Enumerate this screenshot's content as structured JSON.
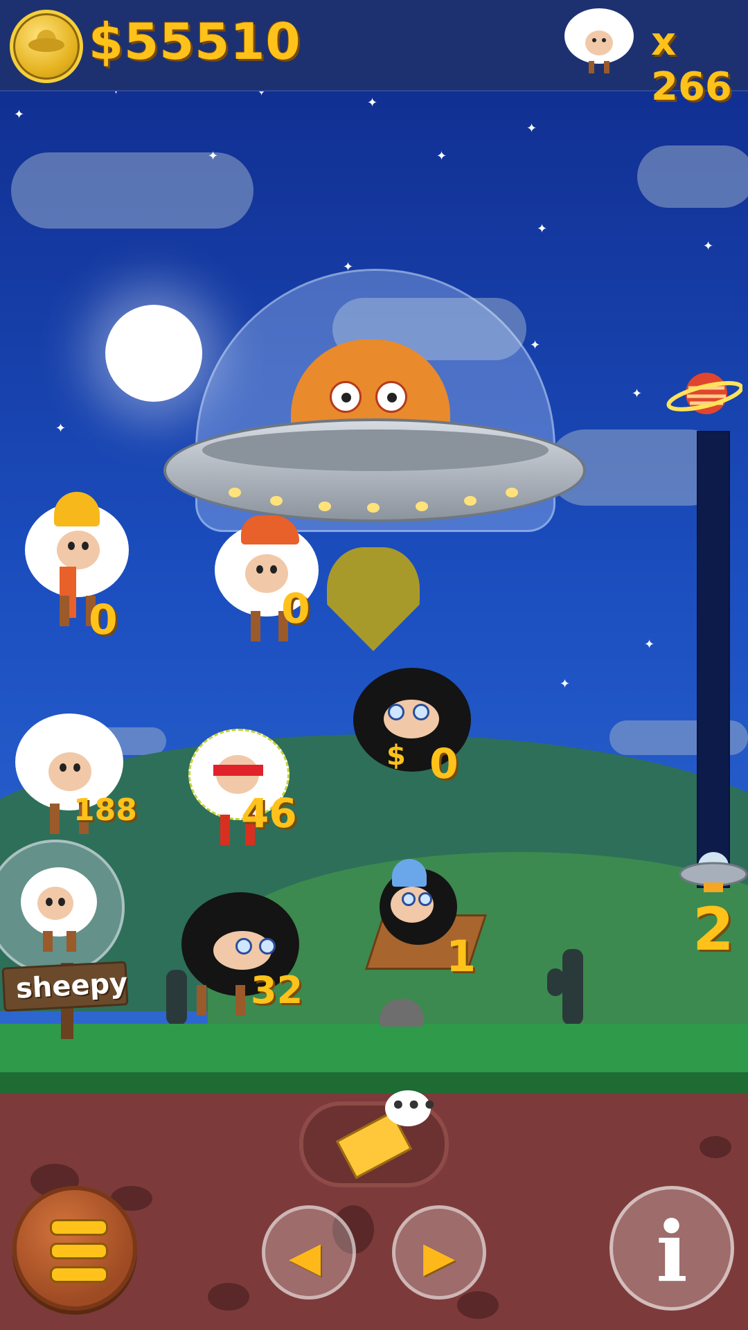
{
  "hud": {
    "money": "$55510",
    "sheep_count": "x 266"
  },
  "sheep": [
    {
      "name": "sheep-beanie-scarf",
      "count": "0"
    },
    {
      "name": "sheep-cap",
      "count": "0"
    },
    {
      "name": "sheep-black-bling",
      "count": "0"
    },
    {
      "name": "sheep-plain",
      "count": "188"
    },
    {
      "name": "sheep-ninja",
      "count": "46"
    },
    {
      "name": "sheep-black-glasses",
      "count": "32"
    },
    {
      "name": "sheep-sled",
      "count": "1"
    }
  ],
  "sign": {
    "label": "sheepy"
  },
  "progress": {
    "level": "2"
  },
  "controls": {
    "info_label": "i",
    "chat_dots": "•••",
    "prev_icon": "◀",
    "next_icon": "▶"
  },
  "icons": [
    "coin-ufo-icon",
    "sheep-icon",
    "envelope-icon",
    "chat-bubble-icon",
    "menu-icon",
    "left-arrow-icon",
    "right-arrow-icon",
    "info-icon",
    "planet-icon",
    "mini-ufo-icon"
  ],
  "colors": {
    "gold": "#ffc21a",
    "sky": "#1c4fc0",
    "soil": "#7c3b3a"
  }
}
